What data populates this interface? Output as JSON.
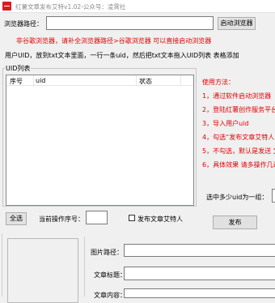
{
  "window": {
    "title": "红薯文章发布艾特v1.02-公众号：凌霄社"
  },
  "browser": {
    "path_label": "浏览器路径：",
    "path_value": "",
    "launch_button": "启动浏览器",
    "warning": "非谷歌浏览器，请补全浏览器路径>谷歌浏览器 可以直接启动浏览器"
  },
  "user_uid": {
    "instruction": "用户UID，放到txt文本里面，一行一条uid，然后把txt文本拖入UID列表 表格添加"
  },
  "uid_list": {
    "group_title": "UID列表",
    "columns": [
      "序号",
      "uid",
      "状态"
    ],
    "rows": []
  },
  "usage": {
    "title": "使用方法：",
    "steps": [
      "1，通过软件启动浏览器",
      "2，登陆红薯创作服务平台",
      "3，导入用户uid",
      "4，勾选“发布文章艾特人",
      "5，不勾选，默认是发送 文",
      "6，具体效果 请多操作几遍"
    ]
  },
  "group_select": {
    "label": "选中多少uid为一组：",
    "value": ""
  },
  "bottom_controls": {
    "select_all": "全选",
    "current_index_label": "当前操作序号：",
    "current_index_value": "",
    "mention_checkbox_label": "发布文章艾特人",
    "mention_checked": false,
    "publish_button": "发布"
  },
  "article": {
    "image_path_label": "图片路径：",
    "image_path_value": "",
    "title_label": "文章标题：",
    "title_value": "",
    "content_label": "文章内容："
  }
}
